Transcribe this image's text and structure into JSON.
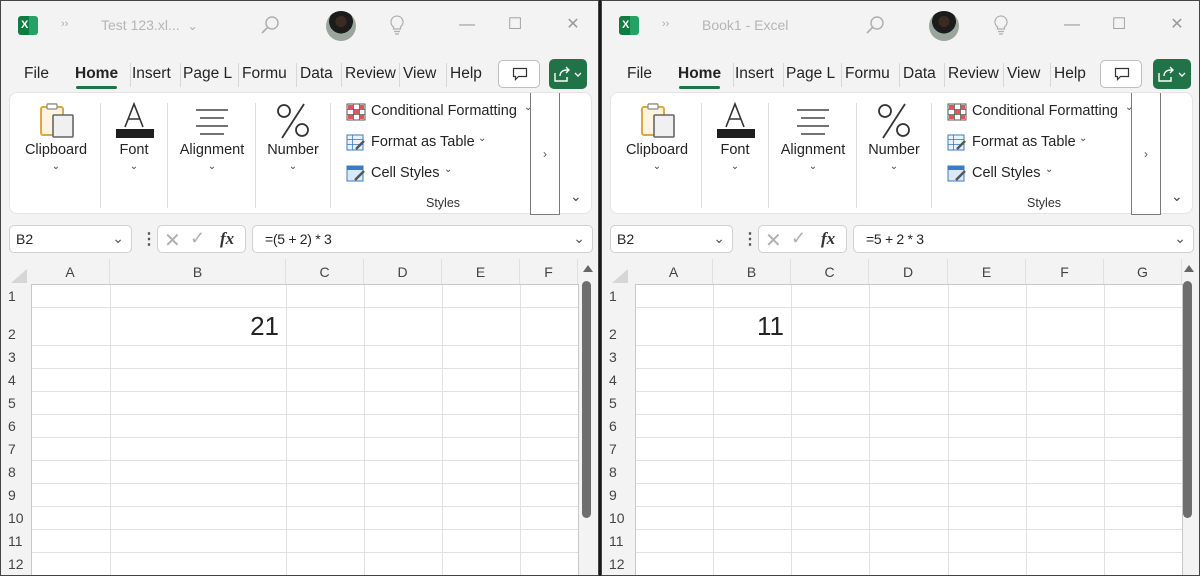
{
  "windows": [
    {
      "id": "left",
      "title": "Test 123.xl...",
      "title_has_chevron": true,
      "tabs": [
        "File",
        "Home",
        "Insert",
        "Page L",
        "Formu",
        "Data",
        "Review",
        "View",
        "Help"
      ],
      "active_tab": "Home",
      "ribbon": {
        "groups": [
          "Clipboard",
          "Font",
          "Alignment",
          "Number"
        ],
        "styles_items": [
          "Conditional Formatting",
          "Format as Table",
          "Cell Styles"
        ],
        "styles_label": "Styles",
        "more_glyph": "›"
      },
      "name_box": "B2",
      "formula": "=(5 + 2) * 3",
      "columns": [
        "A",
        "B",
        "C",
        "D",
        "E",
        "F"
      ],
      "rows": [
        "1",
        "2",
        "3",
        "4",
        "5",
        "6",
        "7",
        "8",
        "9",
        "10",
        "11",
        "12"
      ],
      "cell": {
        "ref": "B2",
        "value": "21"
      }
    },
    {
      "id": "right",
      "title": "Book1  -  Excel",
      "title_has_chevron": false,
      "tabs": [
        "File",
        "Home",
        "Insert",
        "Page L",
        "Formu",
        "Data",
        "Review",
        "View",
        "Help"
      ],
      "active_tab": "Home",
      "ribbon": {
        "groups": [
          "Clipboard",
          "Font",
          "Alignment",
          "Number"
        ],
        "styles_items": [
          "Conditional Formatting",
          "Format as Table",
          "Cell Styles"
        ],
        "styles_label": "Styles",
        "more_glyph": "›"
      },
      "name_box": "B2",
      "formula": "=5 + 2 * 3",
      "columns": [
        "A",
        "B",
        "C",
        "D",
        "E",
        "F",
        "G"
      ],
      "rows": [
        "1",
        "2",
        "3",
        "4",
        "5",
        "6",
        "7",
        "8",
        "9",
        "10",
        "11",
        "12"
      ],
      "cell": {
        "ref": "B2",
        "value": "11"
      }
    }
  ],
  "icons": {
    "app": "excel-icon",
    "more": "chevron-double-right-icon",
    "search": "search-icon",
    "avatar": "user-avatar",
    "tell_me": "lightbulb-icon",
    "minimize": "minimize-icon",
    "maximize": "maximize-icon",
    "close": "close-icon",
    "comment": "comment-icon",
    "share": "share-icon"
  },
  "glyphs": {
    "xl_letter": "X",
    "more": "››",
    "chev_down": "⌄",
    "minimize": "—",
    "maximize": "☐",
    "close": "✕",
    "cancel": "✕",
    "enter": "✓",
    "fx": "fx",
    "vdots": "⋮",
    "collapse": "⌄"
  },
  "colors": {
    "accent_green": "#1f7346",
    "excel_dark": "#107c41",
    "excel_light": "#21a366"
  }
}
